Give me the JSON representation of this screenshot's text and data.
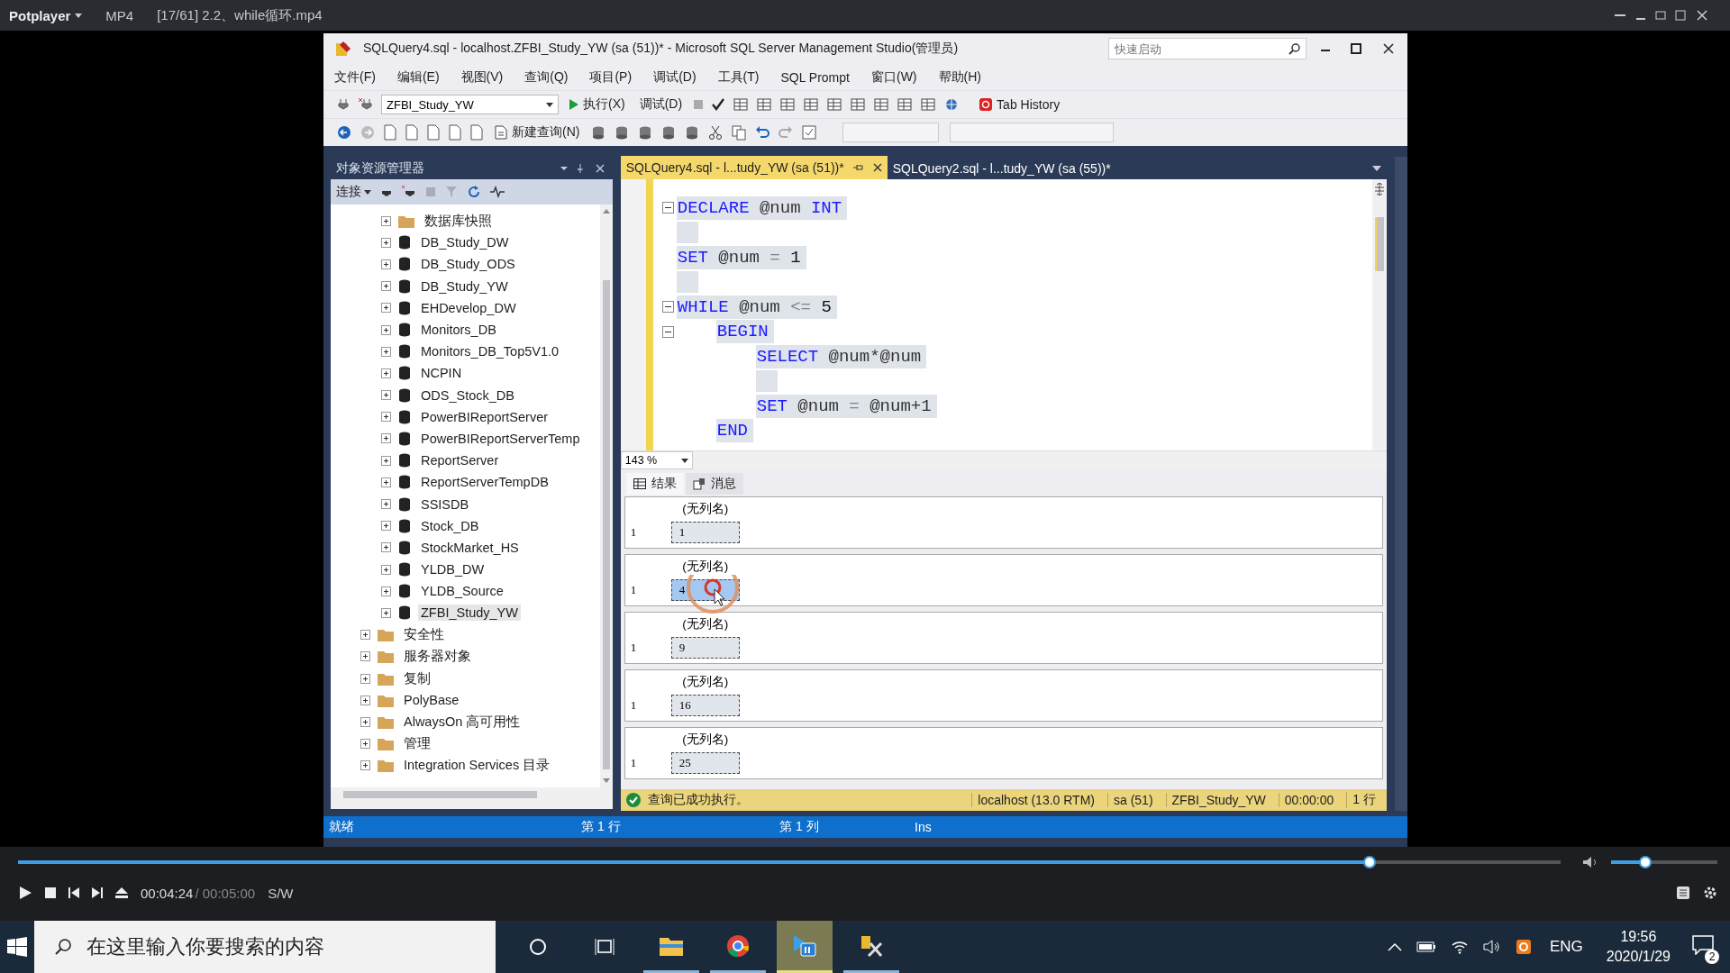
{
  "player": {
    "app_menu": "Potplayer",
    "format": "MP4",
    "file_title": "[17/61] 2.2、while循环.mp4",
    "seek": {
      "level": 0.876
    },
    "volume": {
      "level": 0.32
    },
    "time_current": "00:04:24",
    "time_total": "/ 00:05:00",
    "mode": "S/W"
  },
  "ssms": {
    "title": "SQLQuery4.sql - localhost.ZFBI_Study_YW (sa (51))* - Microsoft SQL Server Management Studio(管理员)",
    "quick_launch": {
      "placeholder": "快速启动"
    },
    "menu": [
      "文件(F)",
      "编辑(E)",
      "视图(V)",
      "查询(Q)",
      "项目(P)",
      "调试(D)",
      "工具(T)",
      "SQL Prompt",
      "窗口(W)",
      "帮助(H)"
    ],
    "toolbar": {
      "database": "ZFBI_Study_YW",
      "execute": "执行(X)",
      "debug": "调试(D)",
      "tab_history": "Tab History",
      "new_query": "新建查询(N)"
    },
    "object_explorer": {
      "title": "对象资源管理器",
      "connect": "连接",
      "databases": [
        {
          "label": "数据库快照",
          "kind": "folder",
          "selected": false
        },
        {
          "label": "DB_Study_DW",
          "kind": "database",
          "selected": false
        },
        {
          "label": "DB_Study_ODS",
          "kind": "database",
          "selected": false
        },
        {
          "label": "DB_Study_YW",
          "kind": "database",
          "selected": false
        },
        {
          "label": "EHDevelop_DW",
          "kind": "database",
          "selected": false
        },
        {
          "label": "Monitors_DB",
          "kind": "database",
          "selected": false
        },
        {
          "label": "Monitors_DB_Top5V1.0",
          "kind": "database",
          "selected": false
        },
        {
          "label": "NCPIN",
          "kind": "database",
          "selected": false
        },
        {
          "label": "ODS_Stock_DB",
          "kind": "database",
          "selected": false
        },
        {
          "label": "PowerBIReportServer",
          "kind": "database",
          "selected": false
        },
        {
          "label": "PowerBIReportServerTemp",
          "kind": "database",
          "selected": false
        },
        {
          "label": "ReportServer",
          "kind": "database",
          "selected": false
        },
        {
          "label": "ReportServerTempDB",
          "kind": "database",
          "selected": false
        },
        {
          "label": "SSISDB",
          "kind": "database",
          "selected": false
        },
        {
          "label": "Stock_DB",
          "kind": "database",
          "selected": false
        },
        {
          "label": "StockMarket_HS",
          "kind": "database",
          "selected": false
        },
        {
          "label": "YLDB_DW",
          "kind": "database",
          "selected": false
        },
        {
          "label": "YLDB_Source",
          "kind": "database",
          "selected": false
        },
        {
          "label": "ZFBI_Study_YW",
          "kind": "database",
          "selected": true
        }
      ],
      "server_nodes": [
        {
          "label": "安全性",
          "kind": "folder",
          "selected": false
        },
        {
          "label": "服务器对象",
          "kind": "folder",
          "selected": false
        },
        {
          "label": "复制",
          "kind": "folder",
          "selected": false
        },
        {
          "label": "PolyBase",
          "kind": "folder",
          "selected": false
        },
        {
          "label": "AlwaysOn 高可用性",
          "kind": "folder",
          "selected": false
        },
        {
          "label": "管理",
          "kind": "folder",
          "selected": false
        },
        {
          "label": "Integration Services 目录",
          "kind": "folder",
          "selected": false
        }
      ]
    },
    "editor": {
      "tabs": [
        {
          "label": "SQLQuery4.sql - l...tudy_YW (sa (51))*",
          "selected": true
        },
        {
          "label": "SQLQuery2.sql - l...tudy_YW (sa (55))*",
          "selected": false
        }
      ],
      "code": [
        {
          "kind": "code",
          "fold": true,
          "tokens": [
            {
              "text": "DECLARE",
              "kind": "keyword"
            },
            {
              "text": "@num",
              "kind": "variable"
            },
            {
              "text": "INT",
              "kind": "keyword"
            }
          ]
        },
        {
          "kind": "blank"
        },
        {
          "kind": "code",
          "fold": false,
          "tokens": [
            {
              "text": "SET",
              "kind": "keyword"
            },
            {
              "text": "@num",
              "kind": "variable"
            },
            {
              "text": "=",
              "kind": "operator"
            },
            {
              "text": "1",
              "kind": "number"
            }
          ]
        },
        {
          "kind": "blank"
        },
        {
          "kind": "code",
          "fold": true,
          "tokens": [
            {
              "text": "WHILE",
              "kind": "keyword"
            },
            {
              "text": "@num",
              "kind": "variable"
            },
            {
              "text": "<=",
              "kind": "operator"
            },
            {
              "text": "5",
              "kind": "number"
            }
          ],
          "children": [
            {
              "kind": "code",
              "fold": true,
              "tokens": [
                {
                  "text": "BEGIN",
                  "kind": "keyword"
                }
              ],
              "children": [
                {
                  "kind": "code",
                  "fold": false,
                  "tokens": [
                    {
                      "text": "SELECT",
                      "kind": "keyword"
                    },
                    {
                      "text": "@num*@num",
                      "kind": "variable"
                    }
                  ]
                },
                {
                  "kind": "blank"
                },
                {
                  "kind": "code",
                  "fold": false,
                  "tokens": [
                    {
                      "text": "SET",
                      "kind": "keyword"
                    },
                    {
                      "text": "@num",
                      "kind": "variable"
                    },
                    {
                      "text": "=",
                      "kind": "operator"
                    },
                    {
                      "text": "@num+1",
                      "kind": "variable"
                    }
                  ]
                }
              ]
            },
            {
              "kind": "code",
              "fold": false,
              "tokens": [
                {
                  "text": "END",
                  "kind": "keyword"
                }
              ]
            }
          ]
        }
      ],
      "zoom": "143 %",
      "result_tabs": [
        {
          "label": "结果",
          "selected": true
        },
        {
          "label": "消息",
          "selected": false
        }
      ],
      "results": [
        {
          "column": "(无列名)",
          "row_number": "1",
          "value": "1",
          "selected": false
        },
        {
          "column": "(无列名)",
          "row_number": "1",
          "value": "4",
          "selected": true
        },
        {
          "column": "(无列名)",
          "row_number": "1",
          "value": "9",
          "selected": false
        },
        {
          "column": "(无列名)",
          "row_number": "1",
          "value": "16",
          "selected": false
        },
        {
          "column": "(无列名)",
          "row_number": "1",
          "value": "25",
          "selected": false
        }
      ],
      "message": "查询已成功执行。",
      "connection_info": [
        "localhost (13.0 RTM)",
        "sa (51)",
        "ZFBI_Study_YW",
        "00:00:00",
        "1 行"
      ]
    },
    "status_bar": [
      "就绪",
      "第 1 行",
      "第 1 列",
      "Ins"
    ]
  },
  "taskbar": {
    "search": {
      "placeholder": "在这里输入你要搜索的内容"
    },
    "apps": [
      {
        "kind": "cortana",
        "selected": false
      },
      {
        "kind": "taskview",
        "selected": false
      },
      {
        "kind": "explorer",
        "selected": false
      },
      {
        "kind": "chrome",
        "selected": false
      },
      {
        "kind": "player",
        "selected": true
      },
      {
        "kind": "tool",
        "selected": false
      }
    ],
    "language": "ENG",
    "time": "19:56",
    "date": "2020/1/29",
    "notifications": "2"
  }
}
